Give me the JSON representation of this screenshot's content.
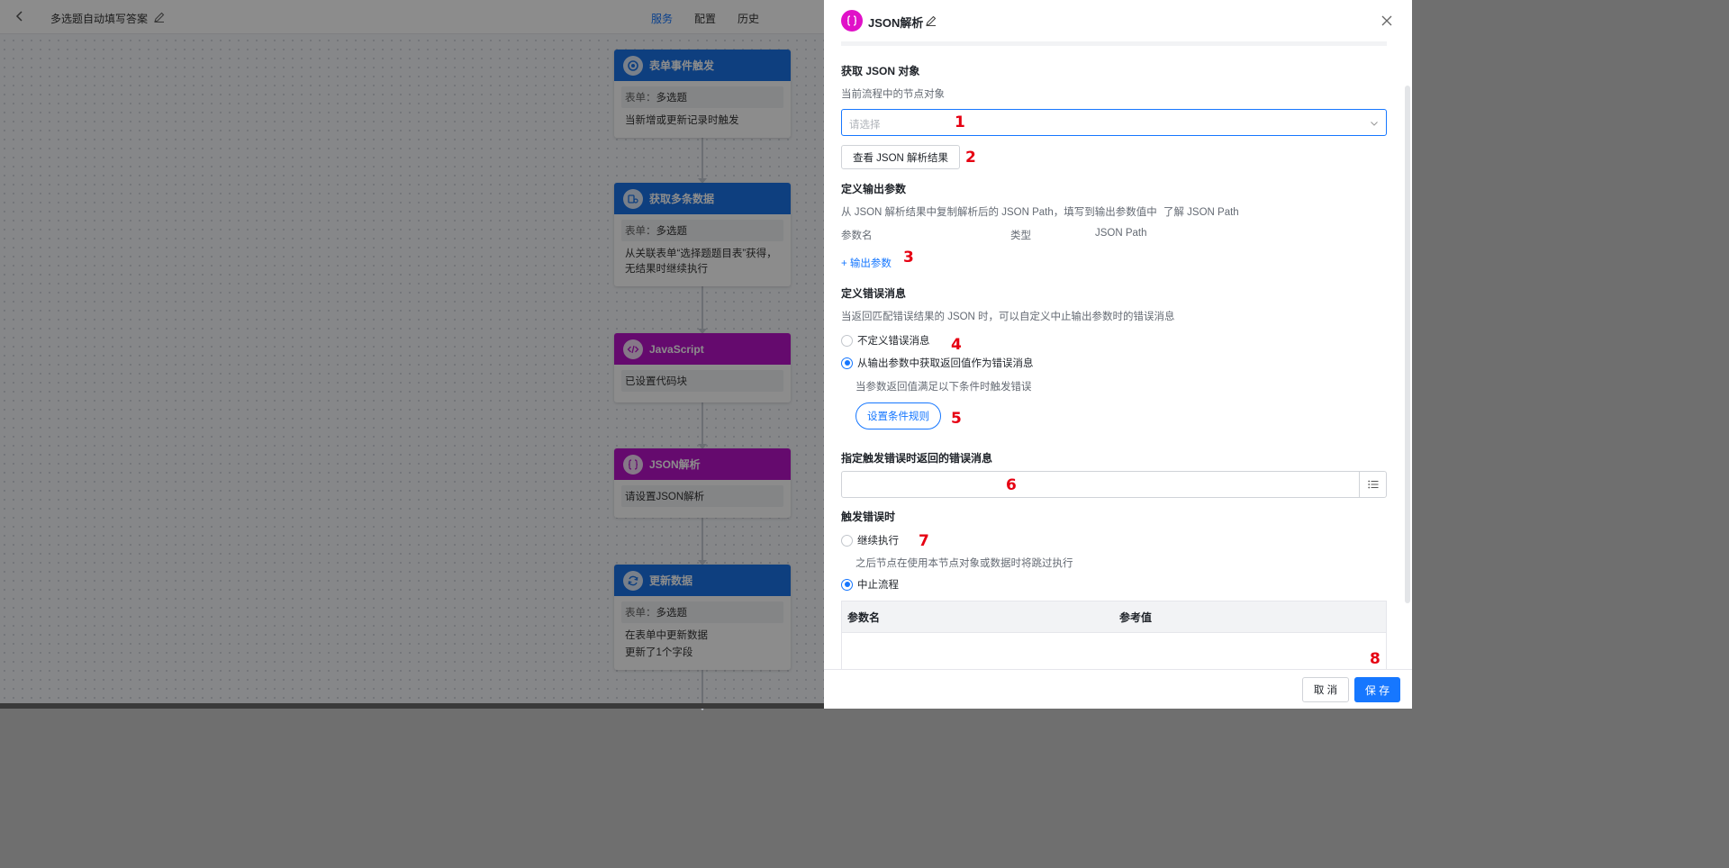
{
  "app": {
    "title": "多选题自动填写答案",
    "tabs": [
      {
        "label": "服务",
        "active": true
      },
      {
        "label": "配置",
        "active": false
      },
      {
        "label": "历史",
        "active": false
      }
    ]
  },
  "nodes": [
    {
      "title": "表单事件触发",
      "color": "blue",
      "chip_label": "表单：",
      "chip_value": "多选题",
      "text": "当新增或更新记录时触发"
    },
    {
      "title": "获取多条数据",
      "color": "blue",
      "chip_label": "表单：",
      "chip_value": "多选题",
      "text": "从关联表单“选择题题目表”获得，无结果时继续执行"
    },
    {
      "title": "JavaScript",
      "color": "purple",
      "chip_value": "已设置代码块"
    },
    {
      "title": "JSON解析",
      "color": "purple",
      "chip_value": "请设置JSON解析"
    },
    {
      "title": "更新数据",
      "color": "blue",
      "chip_label": "表单：",
      "chip_value": "多选题",
      "text": "在表单中更新数据",
      "text2": "更新了1个字段"
    }
  ],
  "drawer": {
    "title": "JSON解析",
    "get_json": {
      "title": "获取 JSON 对象",
      "desc": "当前流程中的节点对象",
      "select_placeholder": "请选择",
      "view_button": "查看 JSON 解析结果"
    },
    "output_params": {
      "title": "定义输出参数",
      "desc": "从 JSON 解析结果中复制解析后的 JSON Path，填写到输出参数值中",
      "learn_link": "了解 JSON Path",
      "col_name": "参数名",
      "col_type": "类型",
      "col_path": "JSON Path",
      "add_link": "+ 输出参数"
    },
    "error_msg": {
      "title": "定义错误消息",
      "desc": "当返回匹配错误结果的 JSON 时，可以自定义中止输出参数时的错误消息",
      "opt_none": "不定义错误消息",
      "opt_from_output": "从输出参数中获取返回值作为错误消息",
      "selected": "opt_from_output",
      "condition_desc": "当参数返回值满足以下条件时触发错误",
      "condition_button": "设置条件规则"
    },
    "error_return": {
      "title": "指定触发错误时返回的错误消息",
      "value": ""
    },
    "on_error": {
      "title": "触发错误时",
      "opt_continue": "继续执行",
      "continue_desc": "之后节点在使用本节点对象或数据时将跳过执行",
      "opt_stop": "中止流程",
      "selected": "opt_stop",
      "col_param": "参数名",
      "col_ref": "参考值"
    },
    "footer": {
      "cancel": "取 消",
      "save": "保 存"
    }
  },
  "markers": [
    "1",
    "2",
    "3",
    "4",
    "5",
    "6",
    "7",
    "8"
  ],
  "colors": {
    "accent": "#1677ff",
    "node_blue": "#1a73e8",
    "node_purple": "#b813c8",
    "json_icon": "#e011c8",
    "marker_red": "#e60012"
  }
}
